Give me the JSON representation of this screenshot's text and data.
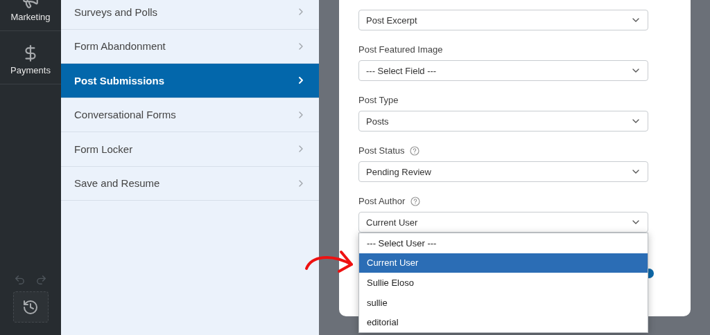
{
  "sidebar": {
    "items": [
      {
        "label": "Marketing",
        "kind": "marketing",
        "selected": false
      },
      {
        "label": "Payments",
        "kind": "payments",
        "selected": false
      }
    ]
  },
  "settings_menu": {
    "items": [
      {
        "label": "Surveys and Polls",
        "selected": false
      },
      {
        "label": "Form Abandonment",
        "selected": false
      },
      {
        "label": "Post Submissions",
        "selected": true
      },
      {
        "label": "Conversational Forms",
        "selected": false
      },
      {
        "label": "Form Locker",
        "selected": false
      },
      {
        "label": "Save and Resume",
        "selected": false
      }
    ]
  },
  "form": {
    "fields": [
      {
        "value": "Post Excerpt"
      },
      {
        "label": "Post Featured Image",
        "value": "--- Select Field ---"
      },
      {
        "label": "Post Type",
        "value": "Posts"
      },
      {
        "label": "Post Status",
        "help": true,
        "value": "Pending Review"
      },
      {
        "label": "Post Author",
        "help": true,
        "value": "Current User",
        "expanded": true,
        "options": [
          {
            "label": "--- Select User ---",
            "selected": false
          },
          {
            "label": "Current User",
            "selected": true
          },
          {
            "label": "Sullie Eloso",
            "selected": false
          },
          {
            "label": "sullie",
            "selected": false
          },
          {
            "label": "editorial",
            "selected": false
          }
        ]
      }
    ]
  }
}
